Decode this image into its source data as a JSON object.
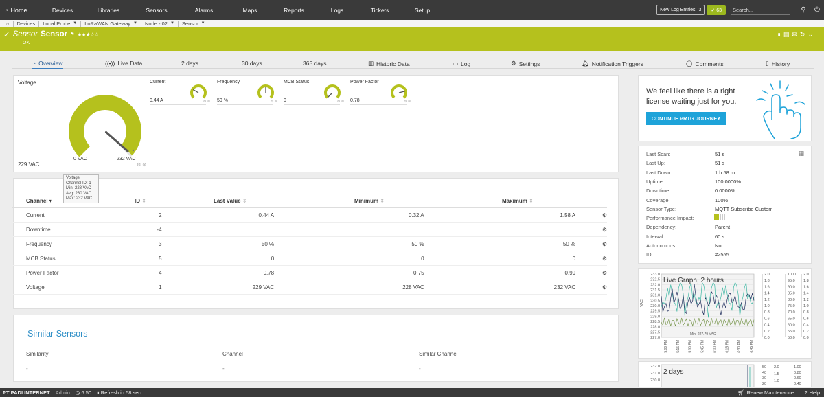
{
  "nav": {
    "home": "Home",
    "items": [
      "Devices",
      "Libraries",
      "Sensors",
      "Alarms",
      "Maps",
      "Reports",
      "Logs",
      "Tickets",
      "Setup"
    ],
    "new_log_label": "New Log Entries",
    "new_log_count": "3",
    "alert_count": "63",
    "search_placeholder": "Search..."
  },
  "breadcrumb": [
    "Devices",
    "Local Probe",
    "LoRaWAN Gateway",
    "Node - 02",
    "Sensor"
  ],
  "sensor": {
    "title_italic": "Sensor",
    "title_bold": "Sensor",
    "stars": "★★★☆☆",
    "status": "OK"
  },
  "tabs": [
    "Overview",
    "Live Data",
    "2  days",
    "30 days",
    "365 days",
    "Historic Data",
    "Log",
    "Settings",
    "Notification Triggers",
    "Comments",
    "History"
  ],
  "voltage_gauge": {
    "title": "Voltage",
    "min_label": "0 VAC",
    "max_label": "232 VAC",
    "value": "229 VAC",
    "fraction": 0.987
  },
  "mini_gauges": [
    {
      "name": "Current",
      "value": "0.44 A",
      "fraction": 0.28
    },
    {
      "name": "Frequency",
      "value": "50 %",
      "fraction": 0.5
    },
    {
      "name": "MCB Status",
      "value": "0",
      "fraction": 0.0
    },
    {
      "name": "Power Factor",
      "value": "0.78",
      "fraction": 0.78
    }
  ],
  "tooltip": [
    "Voltage",
    "Channel ID: 1",
    "Min: 228 VAC",
    "Avg: 230 VAC",
    "Max: 232 VAC"
  ],
  "channels": {
    "headers": [
      "Channel",
      "ID",
      "Last Value",
      "Minimum",
      "Maximum"
    ],
    "rows": [
      {
        "channel": "Current",
        "id": "2",
        "last": "0.44 A",
        "min": "0.32 A",
        "max": "1.58 A"
      },
      {
        "channel": "Downtime",
        "id": "-4",
        "last": "",
        "min": "",
        "max": ""
      },
      {
        "channel": "Frequency",
        "id": "3",
        "last": "50 %",
        "min": "50 %",
        "max": "50 %"
      },
      {
        "channel": "MCB Status",
        "id": "5",
        "last": "0",
        "min": "0",
        "max": "0"
      },
      {
        "channel": "Power Factor",
        "id": "4",
        "last": "0.78",
        "min": "0.75",
        "max": "0.99"
      },
      {
        "channel": "Voltage",
        "id": "1",
        "last": "229 VAC",
        "min": "228 VAC",
        "max": "232 VAC"
      }
    ]
  },
  "similar": {
    "title": "Similar Sensors",
    "headers": [
      "Similarity",
      "Channel",
      "Similar Channel"
    ],
    "row": [
      "-",
      "-",
      "-"
    ]
  },
  "license": {
    "text_line1": "We feel like there is a right",
    "text_line2": "license waiting just for you.",
    "button": "CONTINUE PRTG JOURNEY"
  },
  "info": [
    {
      "k": "Last Scan:",
      "v": "51 s"
    },
    {
      "k": "Last Up:",
      "v": "51 s"
    },
    {
      "k": "Last Down:",
      "v": "1 h 58 m"
    },
    {
      "k": "Uptime:",
      "v": "100.0000%"
    },
    {
      "k": "Downtime:",
      "v": "0.0000%"
    },
    {
      "k": "Coverage:",
      "v": "100%"
    },
    {
      "k": "Sensor Type:",
      "v": "MQTT Subscribe Custom"
    },
    {
      "k": "Performance Impact:",
      "v": ""
    },
    {
      "k": "Dependency:",
      "v": "Parent"
    },
    {
      "k": "Interval:",
      "v": "60 s"
    },
    {
      "k": "Autonomous:",
      "v": "No"
    },
    {
      "k": "ID:",
      "v": "#2555"
    }
  ],
  "graph1": {
    "title": "Live Graph, 2 hours",
    "yaxis_label": "VAC",
    "left_ticks": [
      "233.0",
      "232.5",
      "232.0",
      "231.5",
      "231.0",
      "230.5",
      "230.0",
      "229.5",
      "229.0",
      "228.5",
      "228.0",
      "227.5",
      "227.0"
    ],
    "right_ticks_a": [
      "2.0",
      "1.8",
      "1.6",
      "1.4",
      "1.2",
      "1.0",
      "0.8",
      "0.6",
      "0.4",
      "0.2",
      "0.0"
    ],
    "right_ticks_b": [
      "100.0",
      "95.0",
      "90.0",
      "85.0",
      "80.0",
      "75.0",
      "70.0",
      "65.0",
      "60.0",
      "55.0",
      "50.0"
    ],
    "right_ticks_c": [
      "2.0",
      "1.8",
      "1.6",
      "1.4",
      "1.2",
      "1.0",
      "0.8",
      "0.6",
      "0.4",
      "0.2",
      "0.0"
    ],
    "x_ticks": [
      "5:00 PM",
      "5:15 PM",
      "5:30 PM",
      "5:45 PM",
      "6:00 PM",
      "6:15 PM",
      "6:30 PM",
      "6:45 PM"
    ],
    "min_label": "Min: 227.79 VAC"
  },
  "graph2": {
    "title": "2 days",
    "left_ticks": [
      "232.0",
      "231.0",
      "230.0"
    ],
    "right_ticks_a": [
      "50",
      "40",
      "30",
      "20"
    ],
    "right_ticks_b": [
      "2.0",
      "1.5",
      "1.0"
    ],
    "right_ticks_c": [
      "1.00",
      "0.80",
      "0.60",
      "0.40"
    ]
  },
  "footer": {
    "company": "PT PADI INTERNET",
    "user": "Admin",
    "time": "6:50",
    "refresh": "Refresh in 58 sec",
    "maintenance": "Renew Maintenance",
    "help": "Help"
  },
  "colors": {
    "accent_green": "#b5c11d",
    "dark_bar": "#3a3a3a",
    "link_blue": "#3b7dbf",
    "button_blue": "#1ea3d9"
  }
}
